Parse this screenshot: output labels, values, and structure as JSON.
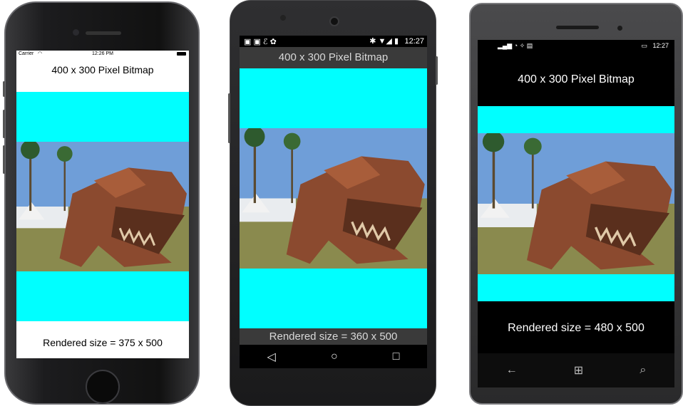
{
  "bitmap_title": "400 x 300 Pixel Bitmap",
  "colors": {
    "cyan": "#00ffff",
    "sky": "#6f9ed8"
  },
  "ios": {
    "status": {
      "carrier": "Carrier",
      "time": "12:26 PM"
    },
    "rendered_label": "Rendered size = 375 x 500"
  },
  "android": {
    "status": {
      "time": "12:27"
    },
    "rendered_label": "Rendered size = 360 x 500",
    "nav": {
      "back": "◁",
      "home": "○",
      "recents": "□"
    }
  },
  "winphone": {
    "status": {
      "time": "12:27"
    },
    "rendered_label": "Rendered size = 480 x 500",
    "nav": {
      "back": "←",
      "start": "⊞",
      "search": "⌕"
    }
  }
}
